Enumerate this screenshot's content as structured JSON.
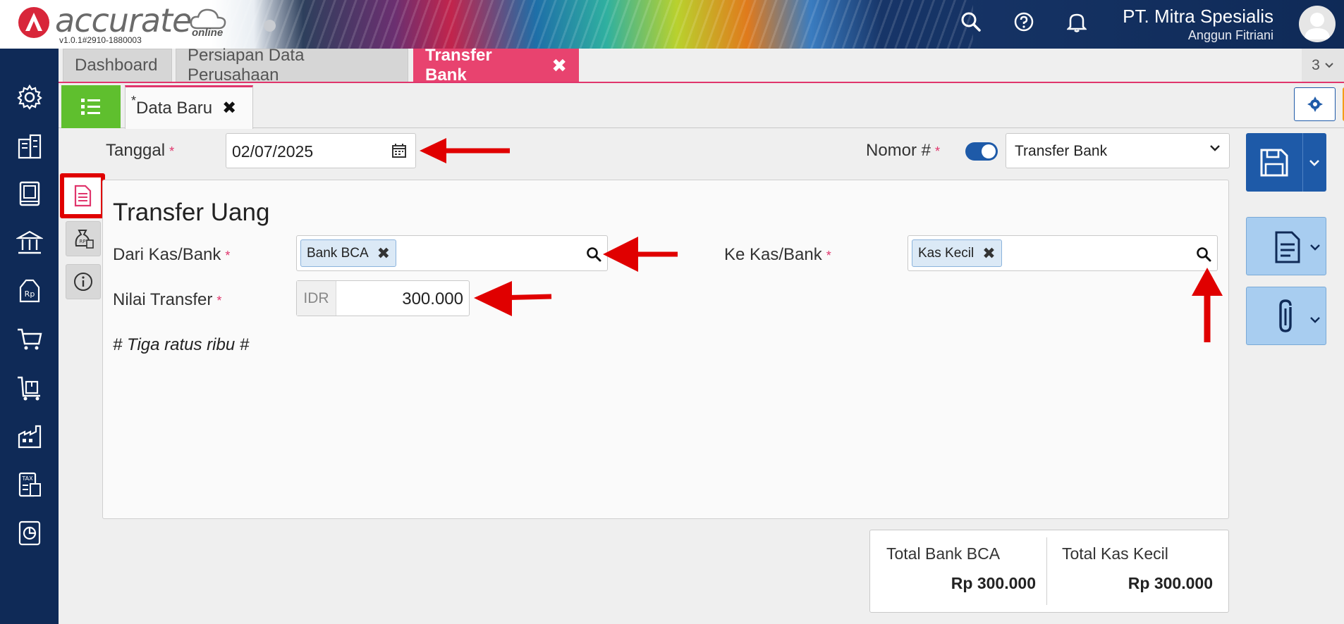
{
  "header": {
    "logo_text": "accurate",
    "logo_suffix": "online",
    "version": "v1.0.1#2910-1880003",
    "company": "PT. Mitra Spesialis",
    "user": "Anggun Fitriani"
  },
  "tabs": [
    {
      "label": "Dashboard"
    },
    {
      "label": "Persiapan Data Perusahaan"
    },
    {
      "label": "Transfer Bank"
    }
  ],
  "tab_count": "3",
  "subtab": {
    "marker": "*",
    "label": "Data Baru"
  },
  "form": {
    "tanggal_label": "Tanggal",
    "tanggal_value": "02/07/2025",
    "nomor_label": "Nomor #",
    "nomor_value": "Transfer Bank",
    "required_mark": "*"
  },
  "panel": {
    "title": "Transfer Uang",
    "dari_label": "Dari Kas/Bank",
    "dari_value": "Bank BCA",
    "ke_label": "Ke Kas/Bank",
    "ke_value": "Kas Kecil",
    "nilai_label": "Nilai Transfer",
    "currency": "IDR",
    "nilai_value": "300.000",
    "terbilang": "# Tiga ratus ribu #"
  },
  "totals": {
    "left_label": "Total Bank BCA",
    "left_value": "Rp 300.000",
    "right_label": "Total Kas Kecil",
    "right_value": "Rp 300.000"
  },
  "colors": {
    "sidebar": "#0f2a57",
    "accent_pink": "#e8436f",
    "primary_blue": "#1e5aa8",
    "green": "#5fbf2e",
    "orange": "#f49d17",
    "annotation_red": "#e00000"
  }
}
